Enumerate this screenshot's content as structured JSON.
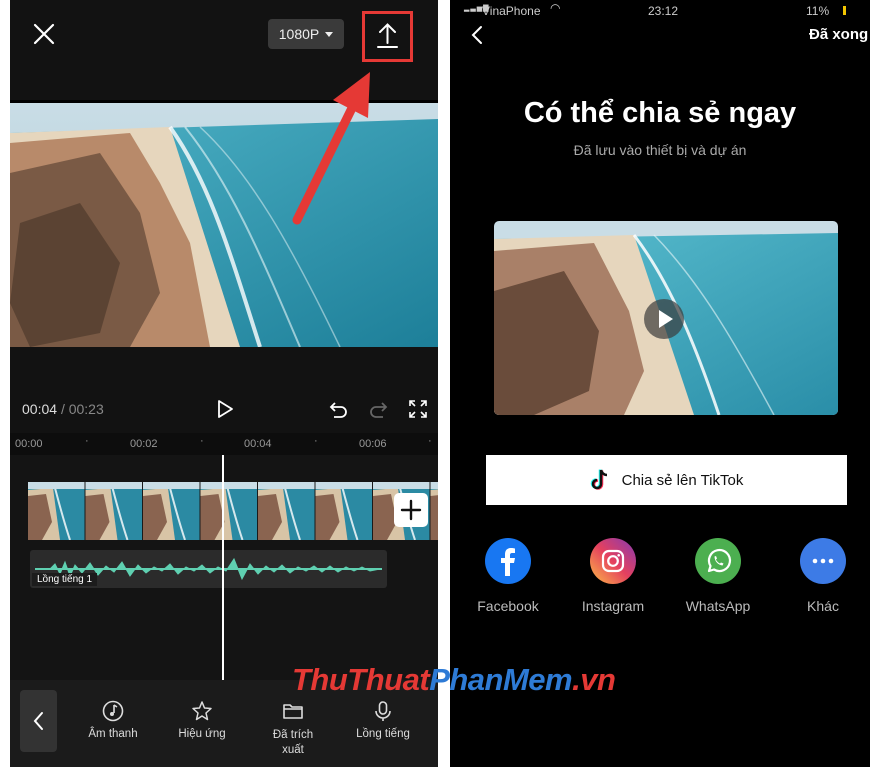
{
  "editor": {
    "resolution": "1080P",
    "time_current": "00:04",
    "time_total": "00:23",
    "ruler_ticks": [
      "00:00",
      "00:02",
      "00:04",
      "00:06"
    ],
    "audio_label": "Lồng tiếng 1",
    "tools": [
      {
        "label": "Âm thanh",
        "icon": "music-note-icon"
      },
      {
        "label": "Hiệu ứng",
        "icon": "star-effect-icon"
      },
      {
        "label": "Đã trích xuất",
        "icon": "folder-icon"
      },
      {
        "label": "Lồng tiếng",
        "icon": "microphone-icon"
      }
    ]
  },
  "share": {
    "status_carrier": "VinaPhone",
    "status_time": "23:12",
    "status_battery": "11%",
    "done_label": "Đã xong",
    "title": "Có thể chia sẻ ngay",
    "subtitle": "Đã lưu vào thiết bị và dự án",
    "tiktok_button": "Chia sẻ lên TikTok",
    "apps": [
      {
        "label": "Facebook",
        "color": "#1877f2",
        "icon": "facebook-icon"
      },
      {
        "label": "Instagram",
        "color": "#d6249f",
        "icon": "instagram-icon"
      },
      {
        "label": "WhatsApp",
        "color": "#4caf50",
        "icon": "whatsapp-icon"
      },
      {
        "label": "Khác",
        "color": "#3d7be6",
        "icon": "more-icon"
      }
    ]
  },
  "watermark": {
    "part1": "ThuThuat",
    "part2": "PhanMem",
    "part3": ".vn"
  },
  "colors": {
    "highlight": "#e53935",
    "sea": "#2a8fa6",
    "waveform": "#5fd0b1"
  }
}
